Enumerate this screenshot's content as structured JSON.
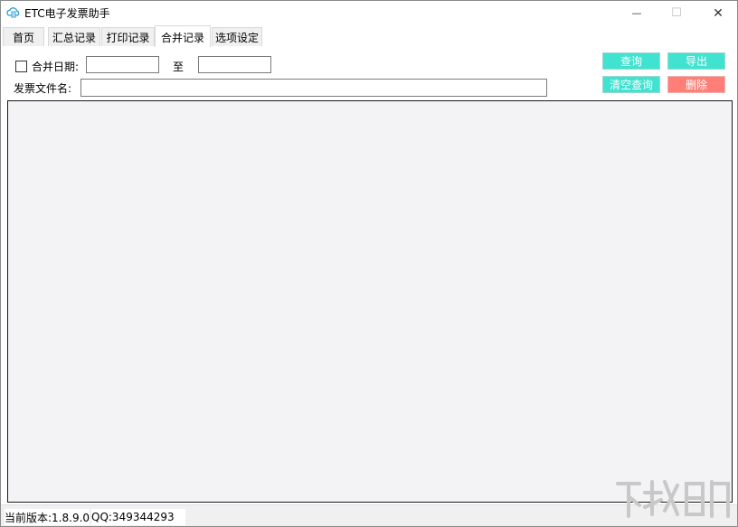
{
  "window": {
    "title": "ETC电子发票助手",
    "controls": {
      "minimize": "—",
      "maximize": "☐",
      "close": "✕"
    }
  },
  "tabs": [
    {
      "label": "首页"
    },
    {
      "label": "汇总记录"
    },
    {
      "label": "打印记录"
    },
    {
      "label": "合并记录",
      "active": true
    },
    {
      "label": "选项设定"
    }
  ],
  "filters": {
    "merge_date_label": "合并日期:",
    "to_label": "至",
    "start_date_value": "",
    "end_date_value": "",
    "file_name_label": "发票文件名:",
    "file_name_value": ""
  },
  "actions": {
    "query": "查询",
    "export": "导出",
    "clear_query": "清空查询",
    "delete": "删除"
  },
  "status": {
    "version": "当前版本:1.8.9.0",
    "qq": "QQ:349344293"
  },
  "colors": {
    "accent_teal": "#3fe3cf",
    "danger_red": "#ff7f78",
    "grid_bg": "#f3f2f5"
  },
  "icons": {
    "app": "receipt-cloud-icon",
    "watermark": "watermark-logo"
  }
}
